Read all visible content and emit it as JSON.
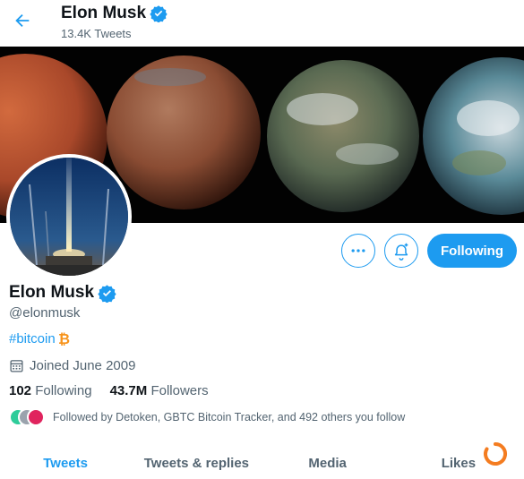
{
  "header": {
    "name": "Elon Musk",
    "tweet_count": "13.4K Tweets",
    "back_icon": "arrow-left-icon"
  },
  "profile": {
    "name": "Elon Musk",
    "handle": "@elonmusk",
    "bio_hashtag": "#bitcoin",
    "joined": "Joined June 2009",
    "following_count": "102",
    "following_label": "Following",
    "followers_count": "43.7M",
    "followers_label": "Followers",
    "followed_by": "Followed by Detoken, GBTC Bitcoin Tracker, and 492 others you follow"
  },
  "actions": {
    "more_icon": "more-icon",
    "notify_icon": "bell-plus-icon",
    "following_label": "Following"
  },
  "tabs": [
    {
      "label": "Tweets",
      "active": true
    },
    {
      "label": "Tweets & replies",
      "active": false
    },
    {
      "label": "Media",
      "active": false
    },
    {
      "label": "Likes",
      "active": false
    }
  ],
  "colors": {
    "accent": "#1d9bf0",
    "text": "#0f1419",
    "muted": "#536471",
    "bitcoin": "#f7931a"
  }
}
